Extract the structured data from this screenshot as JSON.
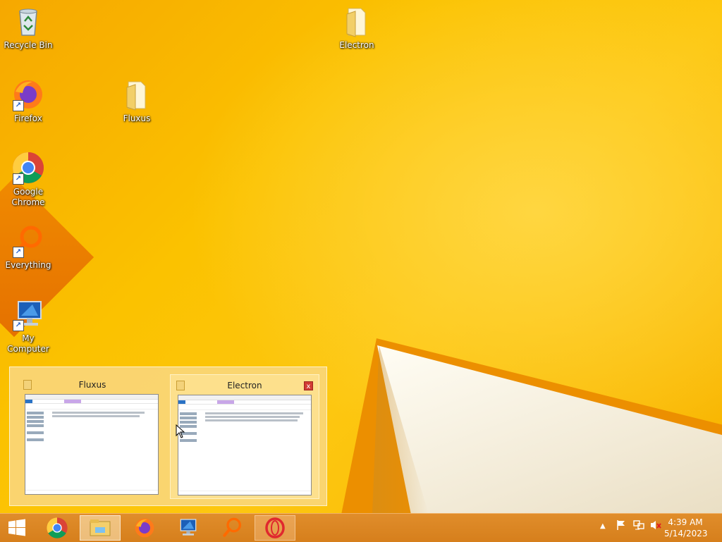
{
  "desktop": {
    "icons": [
      {
        "label": "Recycle Bin",
        "icon": "recycle-bin-icon"
      },
      {
        "label": "Electron",
        "icon": "folder-icon"
      },
      {
        "label": "Firefox",
        "icon": "firefox-icon"
      },
      {
        "label": "Fluxus",
        "icon": "folder-icon"
      },
      {
        "label": "Google Chrome",
        "icon": "chrome-icon"
      },
      {
        "label": "Everything",
        "icon": "everything-search-icon"
      },
      {
        "label": "My Computer",
        "icon": "computer-icon"
      }
    ]
  },
  "thumbnails": {
    "windows": [
      {
        "title": "Fluxus"
      },
      {
        "title": "Electron",
        "close": "x"
      }
    ]
  },
  "taskbar": {
    "buttons": [
      "start-button",
      "chrome",
      "file-explorer",
      "firefox",
      "my-computer",
      "everything",
      "opera"
    ],
    "clock": {
      "time": "4:39 AM",
      "date": "5/14/2023"
    },
    "tray": {
      "expand": "▲"
    }
  },
  "colors": {
    "accent": "#f7b400",
    "taskbar": "#d9821f"
  }
}
